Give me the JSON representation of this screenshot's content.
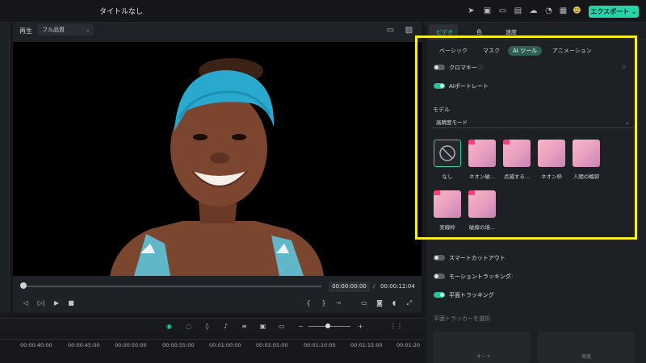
{
  "window": {
    "title": "タイトルなし",
    "export_label": "エクスポート"
  },
  "player": {
    "play_label": "再生",
    "quality": "フル品質",
    "time_current": "00:00:00:00",
    "time_separator": "/",
    "time_total": "00:00:12:04",
    "progress": 0.0
  },
  "panel": {
    "top_tabs": [
      "ビデオ",
      "色",
      "速度"
    ],
    "sub_tabs": [
      "ベーシック",
      "マスク",
      "AI ツール",
      "アニメーション"
    ],
    "chroma_key": "クロマキー",
    "ai_portrait": "AIポートレート",
    "model_label": "モデル",
    "model_value": "高精度モード",
    "effects": [
      "なし",
      "ネオン破...",
      "点滅する...",
      "ネオン枠",
      "人間の輪郭",
      "実線枠",
      "破線の境..."
    ],
    "smart_cutout": "スマートカットアウト",
    "motion_tracking": "モーショントラッキング",
    "planar_tracking": "平面トラッキング",
    "select_tracker": "平面トラッカーを選択",
    "tracker_auto": "オート",
    "tracker_advanced": "高度"
  },
  "timeline": {
    "ticks": [
      "00:00:40:00",
      "00:00:45:00",
      "00:00:50:00",
      "00:00:55:00",
      "00:01:00:00",
      "00:01:05:00",
      "00:01:10:00",
      "00:01:15:00",
      "00:01:20"
    ]
  },
  "colors": {
    "accent": "#27d3a8",
    "highlight": "#f6ec2a",
    "badge": "#ff3d78"
  }
}
